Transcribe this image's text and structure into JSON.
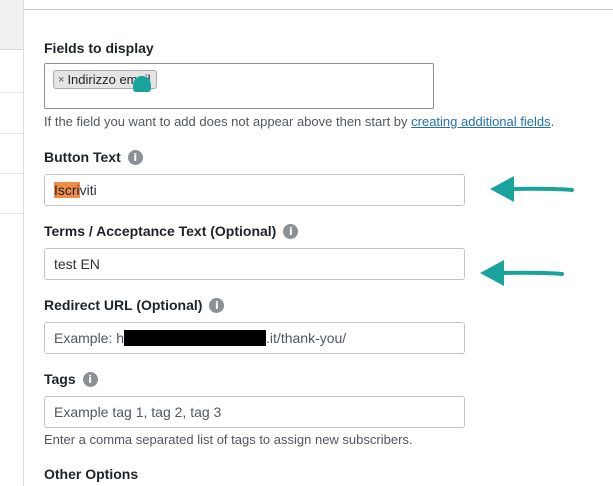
{
  "fields_to_display": {
    "label": "Fields to display",
    "chip_remove": "×",
    "chip_label": "Indirizzo email",
    "help_prefix": "If the field you want to add does not appear above then start by ",
    "help_link": "creating additional fields",
    "help_suffix": "."
  },
  "button_text": {
    "label": "Button Text",
    "value_highlighted": "Iscri",
    "value_rest": "viti"
  },
  "terms_text": {
    "label": "Terms / Acceptance Text (Optional)",
    "value": "test EN"
  },
  "redirect_url": {
    "label": "Redirect URL (Optional)",
    "value_prefix": "Example: h",
    "value_suffix": ".it/thank-you/"
  },
  "tags": {
    "label": "Tags",
    "placeholder": "Example tag 1, tag 2, tag 3",
    "help": "Enter a comma separated list of tags to assign new subscribers."
  },
  "other_options": {
    "label": "Other Options"
  },
  "icons": {
    "info": "i"
  },
  "colors": {
    "accent_arrow": "#1aa39a",
    "highlight": "#f08c46",
    "link": "#2271b1"
  }
}
